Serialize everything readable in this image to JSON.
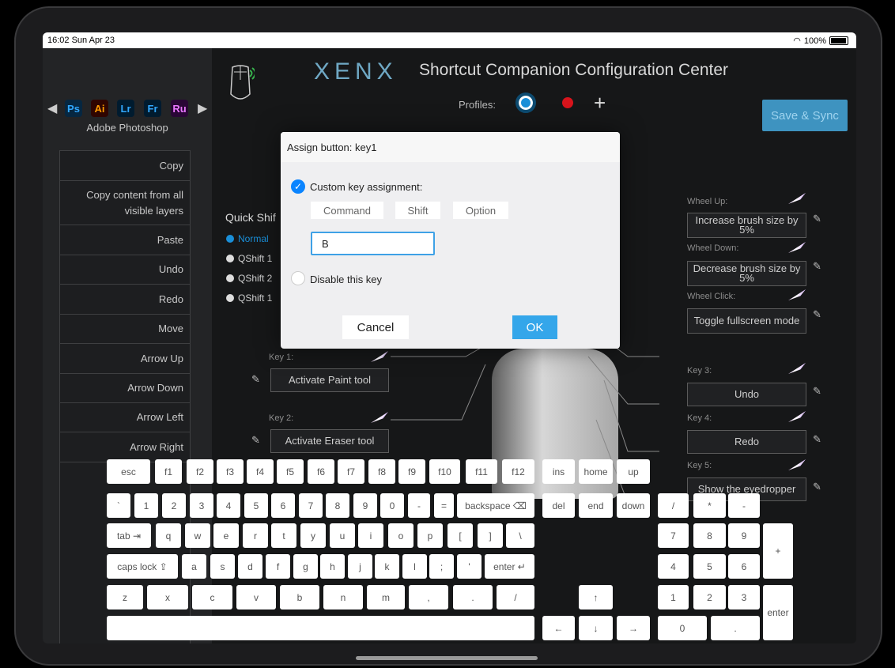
{
  "status": {
    "time_date": "16:02  Sun Apr 23",
    "battery": "100%"
  },
  "sidebar": {
    "tabs": [
      "Ps",
      "Ai",
      "Lr",
      "Fr",
      "Ru"
    ],
    "app_name": "Adobe Photoshop",
    "shortcuts": [
      "Copy",
      "Copy content from all visible layers",
      "Paste",
      "Undo",
      "Redo",
      "Move",
      "Arrow Up",
      "Arrow Down",
      "Arrow Left",
      "Arrow Right"
    ]
  },
  "header": {
    "brand": "XENX",
    "title": "Shortcut Companion Configuration Center",
    "profiles_label": "Profiles:",
    "save_sync": "Save & Sync"
  },
  "quickshift": {
    "title": "Quick Shif",
    "options": [
      "Normal",
      "QShift 1",
      "QShift 2",
      "QShift 1"
    ]
  },
  "left_keys": [
    {
      "label": "Key 1:",
      "value": "Activate Paint tool"
    },
    {
      "label": "Key 2:",
      "value": "Activate Eraser tool"
    }
  ],
  "right_keys": [
    {
      "label": "Wheel Up:",
      "value": "Increase brush size by 5%"
    },
    {
      "label": "Wheel Down:",
      "value": "Decrease brush size by 5%"
    },
    {
      "label": "Wheel Click:",
      "value": "Toggle fullscreen mode"
    },
    {
      "label": "Key 3:",
      "value": "Undo"
    },
    {
      "label": "Key 4:",
      "value": "Redo"
    },
    {
      "label": "Key 5:",
      "value": "Show the eyedropper"
    }
  ],
  "dialog": {
    "title": "Assign button: key1",
    "custom_label": "Custom key assignment:",
    "modifiers": [
      "Command",
      "Shift",
      "Option"
    ],
    "key_value": "B",
    "disable_label": "Disable this key",
    "cancel": "Cancel",
    "ok": "OK"
  },
  "keyboard": {
    "row1": [
      "esc",
      "f1",
      "f2",
      "f3",
      "f4",
      "f5",
      "f6",
      "f7",
      "f8",
      "f9",
      "f10",
      "f11",
      "f12"
    ],
    "row1_nav": [
      "ins",
      "home",
      "up"
    ],
    "row2": [
      "`",
      "1",
      "2",
      "3",
      "4",
      "5",
      "6",
      "7",
      "8",
      "9",
      "0",
      "-",
      "=",
      "backspace ⌫"
    ],
    "row2_nav": [
      "del",
      "end",
      "down"
    ],
    "row3": [
      "tab ⇥",
      "q",
      "w",
      "e",
      "r",
      "t",
      "y",
      "u",
      "i",
      "o",
      "p",
      "[",
      "]",
      "\\"
    ],
    "row4": [
      "caps lock ⇪",
      "a",
      "s",
      "d",
      "f",
      "g",
      "h",
      "j",
      "k",
      "l",
      ";",
      "'",
      "enter ↵"
    ],
    "row5": [
      "z",
      "x",
      "c",
      "v",
      "b",
      "n",
      "m",
      ",",
      ".",
      "/"
    ],
    "arrows": [
      "↑",
      "←",
      "↓",
      "→"
    ],
    "numpad": {
      "top": [
        "/",
        "*",
        "-"
      ],
      "r1": [
        "7",
        "8",
        "9"
      ],
      "r2": [
        "4",
        "5",
        "6"
      ],
      "r3": [
        "1",
        "2",
        "3"
      ],
      "zero": "0",
      "dot": ".",
      "plus": "+",
      "enter": "enter"
    }
  },
  "colors": {
    "accent": "#34a6ea",
    "profile_blue": "#1a8fd8",
    "profile_red": "#d8141c",
    "ps": "#31a8ff",
    "ai": "#ff9a00",
    "lr": "#31a8ff",
    "fr": "#31a8ff",
    "ru": "#ea77ff"
  }
}
